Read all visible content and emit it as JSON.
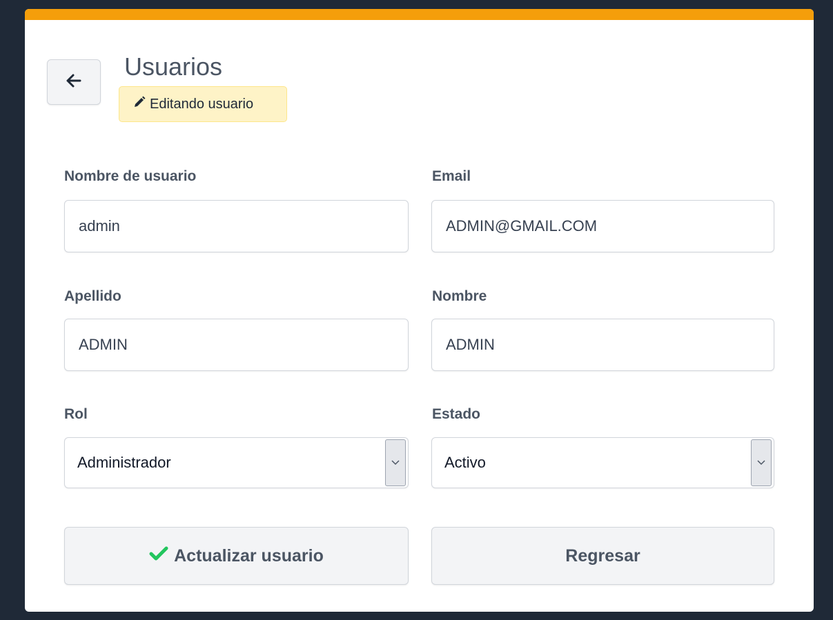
{
  "header": {
    "title": "Usuarios",
    "badge_label": "Editando usuario",
    "back_icon": "arrow-left-icon",
    "badge_icon": "pencil-icon"
  },
  "form": {
    "username": {
      "label": "Nombre de usuario",
      "value": "admin"
    },
    "email": {
      "label": "Email",
      "value": "ADMIN@GMAIL.COM"
    },
    "lastname": {
      "label": "Apellido",
      "value": "ADMIN"
    },
    "firstname": {
      "label": "Nombre",
      "value": "ADMIN"
    },
    "role": {
      "label": "Rol",
      "value": "Administrador"
    },
    "status": {
      "label": "Estado",
      "value": "Activo"
    }
  },
  "actions": {
    "update_label": "Actualizar usuario",
    "update_icon": "check-icon",
    "back_label": "Regresar"
  },
  "colors": {
    "accent_bar": "#f59e0b",
    "page_background": "#1f2937",
    "badge_background": "#fef3c7",
    "check_icon": "#22c55e"
  }
}
